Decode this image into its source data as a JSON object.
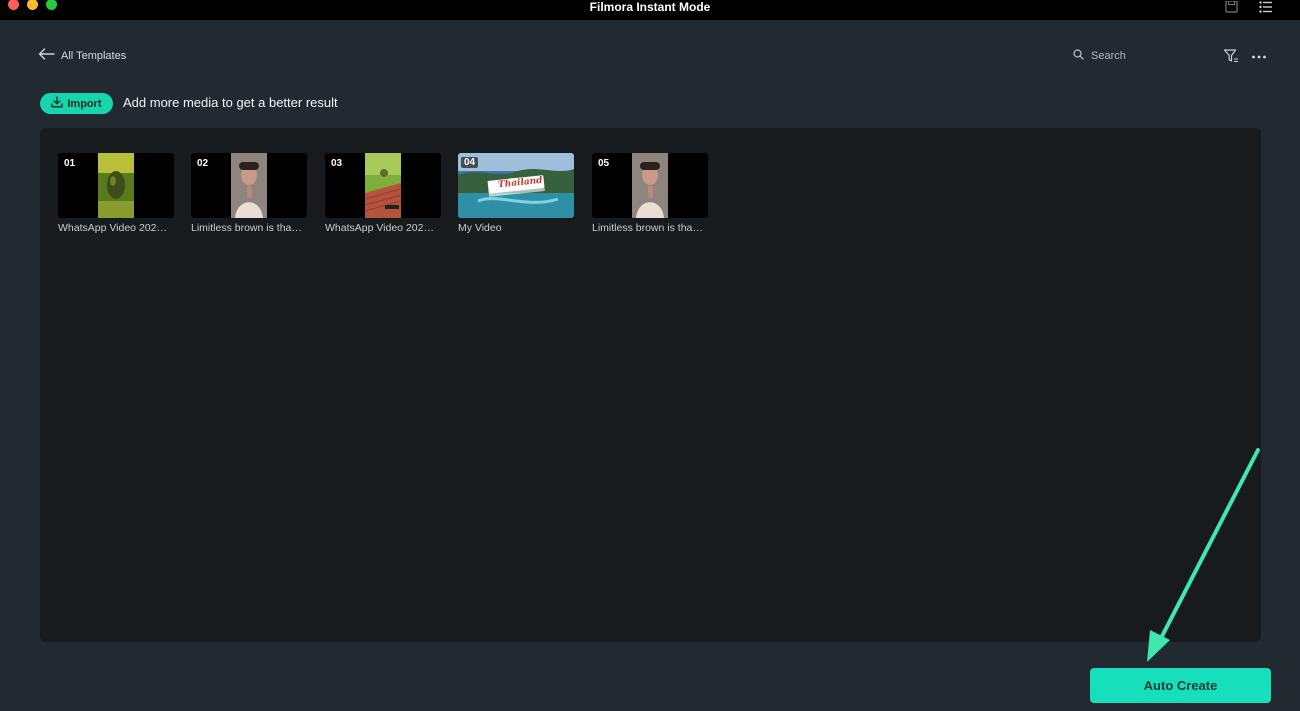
{
  "window": {
    "title": "Filmora Instant Mode"
  },
  "header": {
    "back_label": "All Templates",
    "search_placeholder": "Search"
  },
  "toolbar": {
    "import_label": "Import",
    "hint_text": "Add more media to get a better result"
  },
  "media": {
    "items": [
      {
        "index": "01",
        "name": "WhatsApp Video 202…"
      },
      {
        "index": "02",
        "name": "Limitless brown is tha…"
      },
      {
        "index": "03",
        "name": "WhatsApp Video 202…"
      },
      {
        "index": "04",
        "name": "My Video",
        "overlay_text": "Thailand"
      },
      {
        "index": "05",
        "name": "Limitless brown is tha…"
      }
    ]
  },
  "footer": {
    "auto_create_label": "Auto Create"
  },
  "colors": {
    "accent": "#16d6ad",
    "background": "#222a31",
    "panel": "#171b1e",
    "annotation_arrow": "#3fe7b3"
  }
}
